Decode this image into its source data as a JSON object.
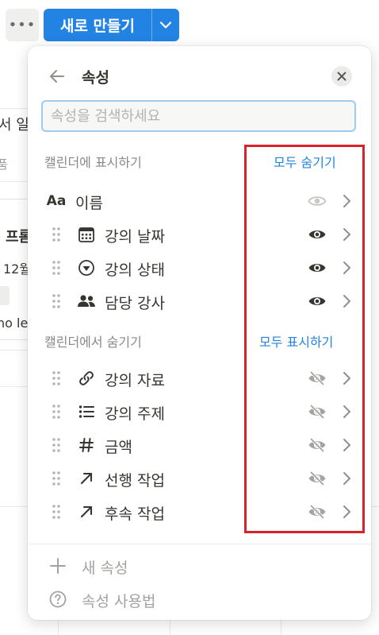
{
  "toolbar": {
    "more_icon": "more-horizontal-icon",
    "new_button_label": "새로 만들기",
    "new_button_dropdown_icon": "chevron-down-icon"
  },
  "background": {
    "fragments": [
      "서 일",
      "품",
      "프롬",
      "12월",
      "ho le"
    ]
  },
  "panel": {
    "title": "속성",
    "back_icon": "arrow-left-icon",
    "close_icon": "close-icon",
    "search": {
      "placeholder": "속성을 검색하세요",
      "value": ""
    },
    "shown_section": {
      "label": "캘린더에 표시하기",
      "action": "모두 숨기기",
      "items": [
        {
          "label": "이름",
          "icon": "text-aa-icon",
          "visible": true,
          "toggle_locked": true,
          "draggable": false
        },
        {
          "label": "강의 날짜",
          "icon": "calendar-icon",
          "visible": true,
          "toggle_locked": false,
          "draggable": true
        },
        {
          "label": "강의 상태",
          "icon": "status-circle-icon",
          "visible": true,
          "toggle_locked": false,
          "draggable": true
        },
        {
          "label": "담당 강사",
          "icon": "people-icon",
          "visible": true,
          "toggle_locked": false,
          "draggable": true
        }
      ]
    },
    "hidden_section": {
      "label": "캘린더에서 숨기기",
      "action": "모두 표시하기",
      "items": [
        {
          "label": "강의 자료",
          "icon": "link-icon",
          "visible": false
        },
        {
          "label": "강의 주제",
          "icon": "list-icon",
          "visible": false
        },
        {
          "label": "금액",
          "icon": "hash-icon",
          "visible": false
        },
        {
          "label": "선행 작업",
          "icon": "arrow-up-right-icon",
          "visible": false
        },
        {
          "label": "후속 작업",
          "icon": "arrow-up-right-icon",
          "visible": false
        }
      ]
    },
    "footer": {
      "new_property": {
        "label": "새 속성",
        "icon": "plus-icon"
      },
      "help": {
        "label": "속성 사용법",
        "icon": "help-circle-icon"
      }
    }
  },
  "colors": {
    "accent": "#2383e2",
    "highlight_box": "#d8232a",
    "text": "#37352f",
    "muted": "#8a8985"
  }
}
